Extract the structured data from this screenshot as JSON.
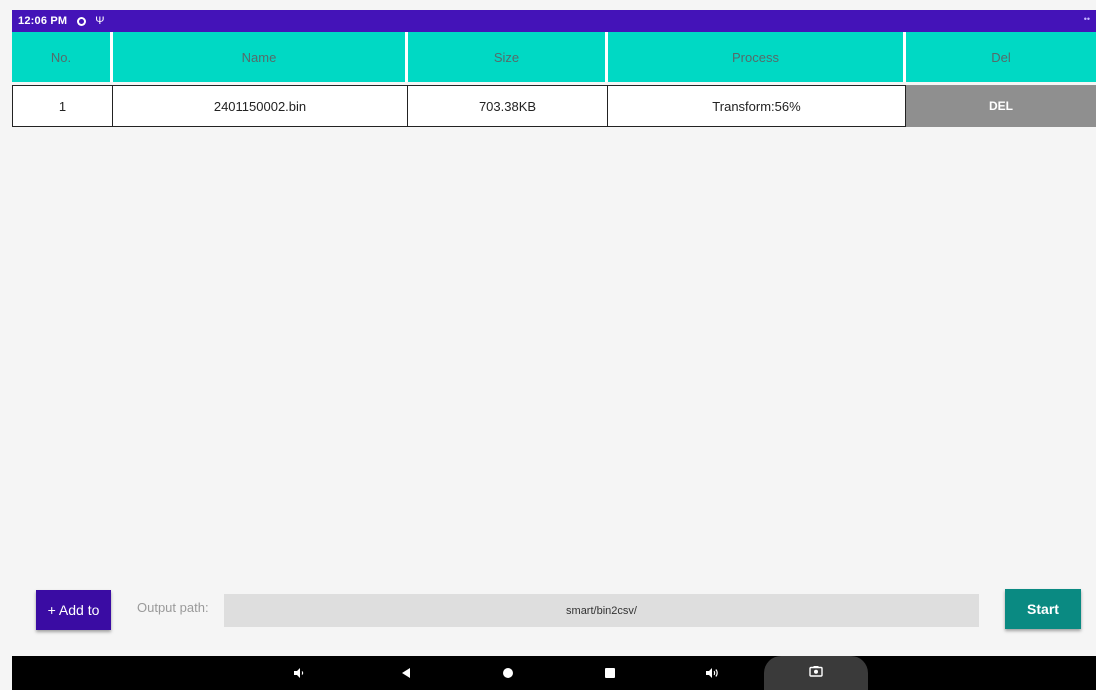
{
  "status_bar": {
    "time": "12:06 PM",
    "usb_symbol": "Ψ",
    "right_indicator": "••"
  },
  "table": {
    "headers": [
      "No.",
      "Name",
      "Size",
      "Process",
      "Del"
    ],
    "rows": [
      {
        "no": "1",
        "name": "2401150002.bin",
        "size": "703.38KB",
        "process": "Transform:56%",
        "del_label": "DEL"
      }
    ]
  },
  "controls": {
    "add_label": "+ Add to",
    "output_label": "Output path:",
    "output_value": "smart/bin2csv/",
    "start_label": "Start"
  },
  "nav_bar": {
    "icons": [
      "volume-down-icon",
      "back-icon",
      "home-icon",
      "recents-icon",
      "volume-up-icon",
      "screenshot-icon"
    ]
  },
  "colors": {
    "status_bar": "#4413b8",
    "header_bg": "#00d9c4",
    "header_text": "#556b6a",
    "del_bg": "#8f8f8f",
    "add_button": "#3a0ca3",
    "start_button": "#0a8a82",
    "nav_bar": "#000000"
  }
}
